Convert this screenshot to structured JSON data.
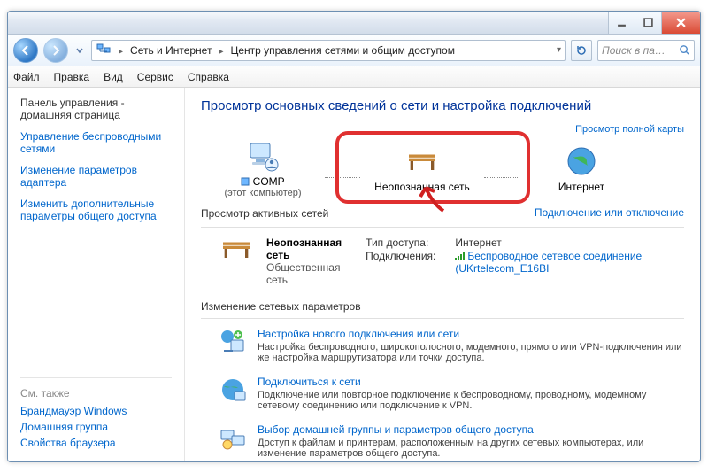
{
  "titlebar": {},
  "nav": {
    "path_icon": "network-center-icon",
    "crumb1": "Сеть и Интернет",
    "crumb2": "Центр управления сетями и общим доступом",
    "search_placeholder": "Поиск в па…"
  },
  "menu": {
    "file": "Файл",
    "edit": "Правка",
    "view": "Вид",
    "service": "Сервис",
    "help": "Справка"
  },
  "sidebar": {
    "home": "Панель управления - домашняя страница",
    "wireless": "Управление беспроводными сетями",
    "adapter": "Изменение параметров адаптера",
    "sharing": "Изменить дополнительные параметры общего доступа",
    "see_also": "См. также",
    "firewall": "Брандмауэр Windows",
    "homegroup": "Домашняя группа",
    "browser": "Свойства браузера"
  },
  "main": {
    "heading": "Просмотр основных сведений о сети и настройка подключений",
    "full_map": "Просмотр полной карты",
    "map": {
      "comp_name": "COMP",
      "comp_sub": "(этот компьютер)",
      "unknown": "Неопознанная сеть",
      "internet": "Интернет"
    },
    "active_hdr": "Просмотр активных сетей",
    "connect_link": "Подключение или отключение",
    "network": {
      "name": "Неопознанная сеть",
      "category": "Общественная сеть",
      "access_k": "Тип доступа:",
      "access_v": "Интернет",
      "conn_k": "Подключения:",
      "conn_v": "Беспроводное сетевое соединение (UKrtelecom_E16BI"
    },
    "change_hdr": "Изменение сетевых параметров",
    "tasks": [
      {
        "title": "Настройка нового подключения или сети",
        "desc": "Настройка беспроводного, широкополосного, модемного, прямого или VPN-подключения или же настройка маршрутизатора или точки доступа."
      },
      {
        "title": "Подключиться к сети",
        "desc": "Подключение или повторное подключение к беспроводному, проводному, модемному сетевому соединению или подключение к VPN."
      },
      {
        "title": "Выбор домашней группы и параметров общего доступа",
        "desc": "Доступ к файлам и принтерам, расположенным на других сетевых компьютерах, или изменение параметров общего доступа."
      }
    ]
  }
}
